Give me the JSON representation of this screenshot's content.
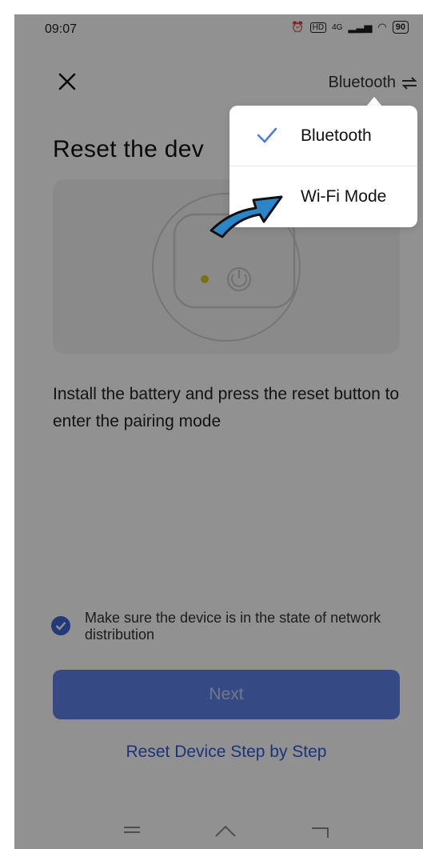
{
  "status_bar": {
    "time": "09:07",
    "network": "4G",
    "battery": "90"
  },
  "header": {
    "mode_label": "Bluetooth"
  },
  "page": {
    "title": "Reset the dev",
    "instructions": "Install the battery and press the reset button to enter the pairing mode",
    "confirm_text": "Make sure the device is in the state of network distribution",
    "confirm_checked": true,
    "next_label": "Next",
    "step_link": "Reset Device Step by Step"
  },
  "dropdown": {
    "items": [
      {
        "label": "Bluetooth",
        "selected": true
      },
      {
        "label": "Wi-Fi Mode",
        "selected": false
      }
    ]
  },
  "colors": {
    "accent": "#3f66d6",
    "primary_button": "#5d83e8",
    "link": "#2f5bd8",
    "check_mark": "#4a7bd9",
    "annotation_arrow": "#2b86c9"
  }
}
